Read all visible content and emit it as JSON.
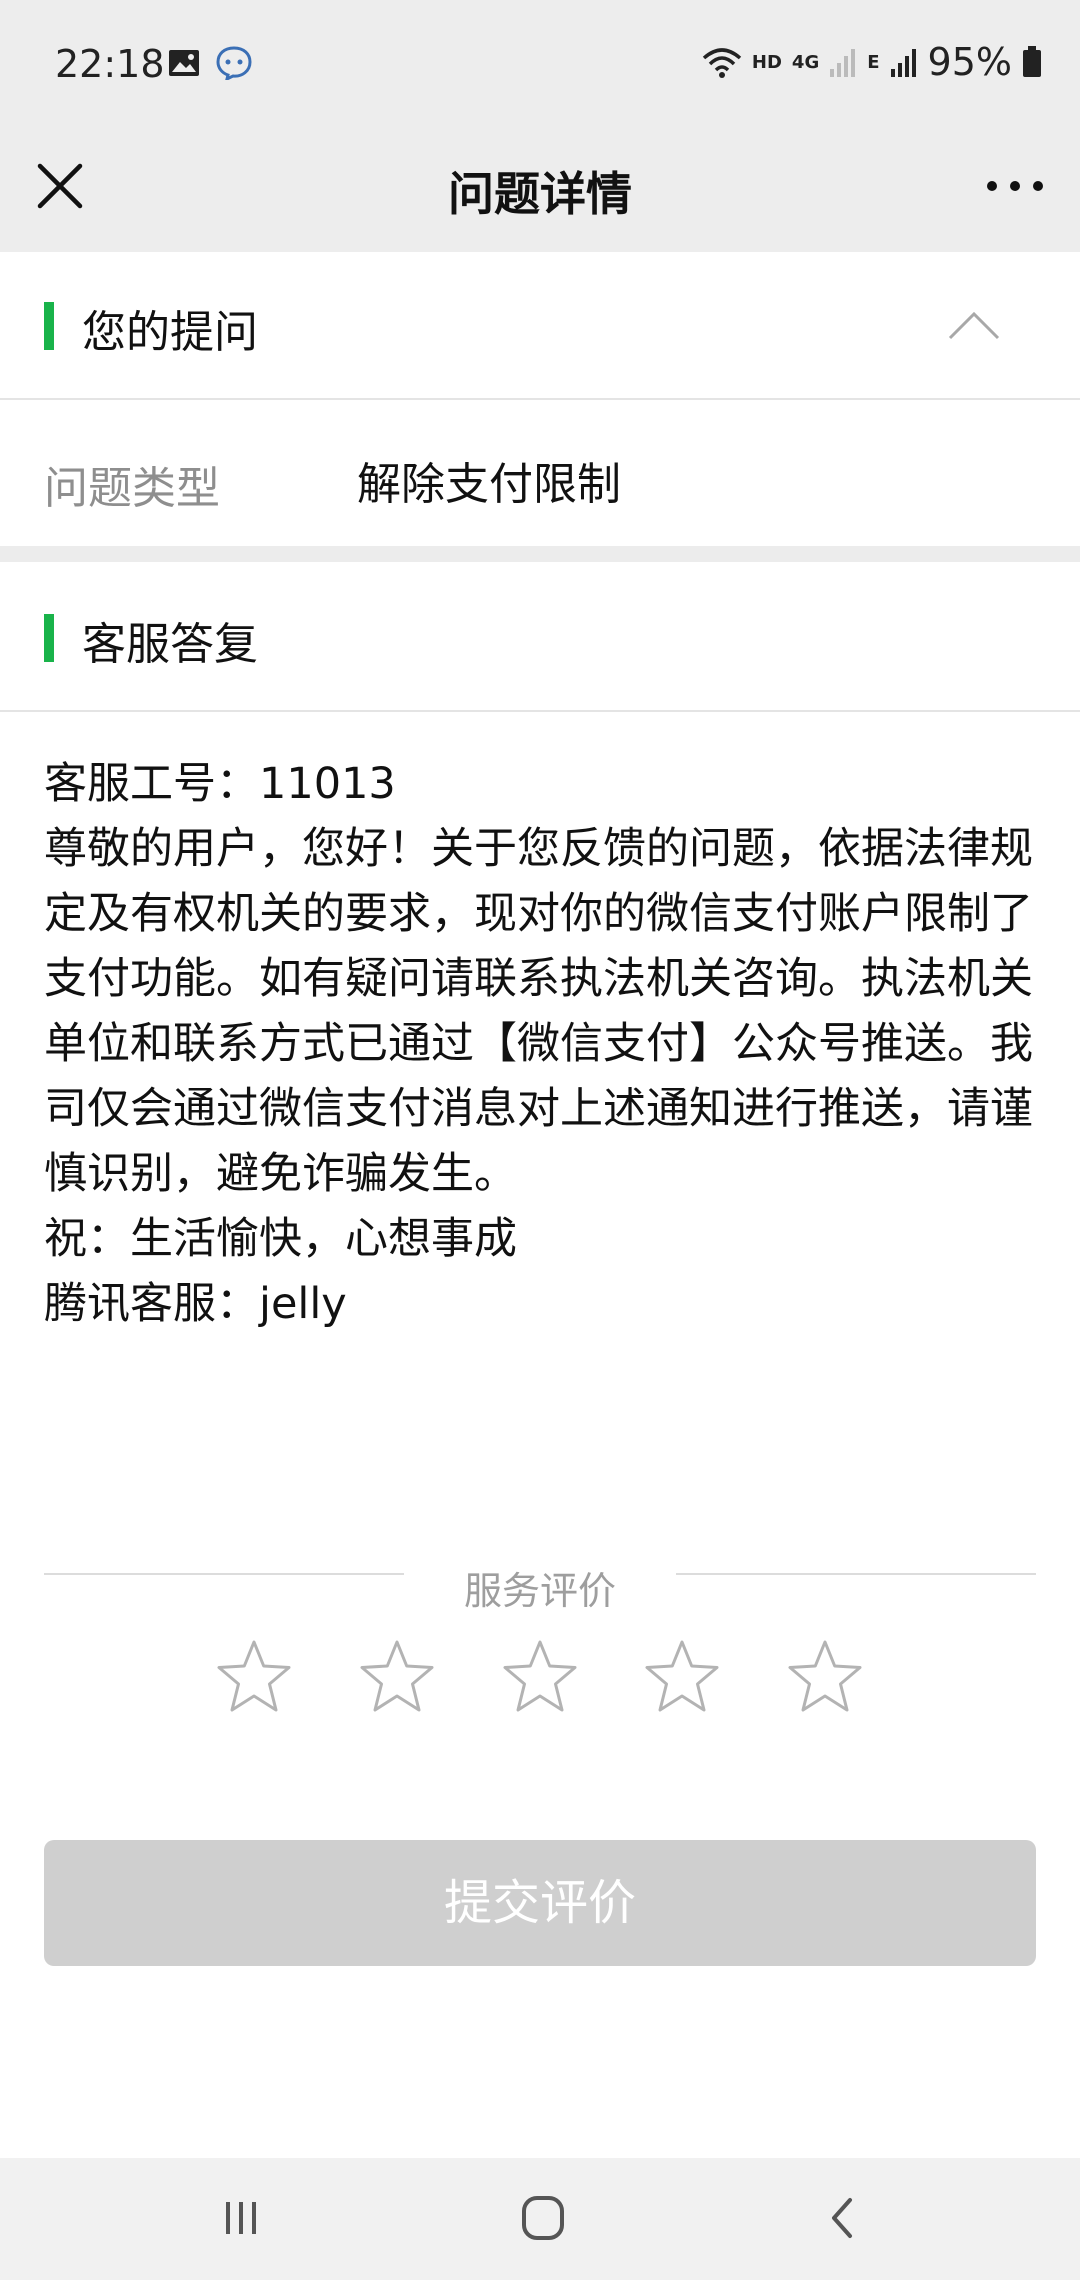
{
  "status": {
    "time": "22:18",
    "hd": "HD",
    "net1": "4G",
    "net2": "E",
    "battery": "95%"
  },
  "nav": {
    "title": "问题详情"
  },
  "question_section": {
    "title": "您的提问",
    "type_label": "问题类型",
    "type_value": "解除支付限制"
  },
  "reply_section": {
    "title": "客服答复",
    "lines": [
      "客服工号：11013",
      "尊敬的用户，您好！关于您反馈的问题，依据法律规定及有权机关的要求，现对你的微信支付账户限制了支付功能。如有疑问请联系执法机关咨询。执法机关单位和联系方式已通过【微信支付】公众号推送。我司仅会通过微信支付消息对上述通知进行推送，请谨慎识别，避免诈骗发生。",
      "祝：生活愉快，心想事成",
      "腾讯客服：jelly"
    ]
  },
  "rating": {
    "label": "服务评价",
    "stars_selected": 0,
    "stars_total": 5
  },
  "submit_label": "提交评价",
  "colors": {
    "accent_green": "#19b34a",
    "button_disabled": "#cfcfcf"
  },
  "icons": {
    "close": "close-icon",
    "more": "more-icon",
    "collapse": "chevron-up-icon",
    "star": "star-outline-icon"
  }
}
